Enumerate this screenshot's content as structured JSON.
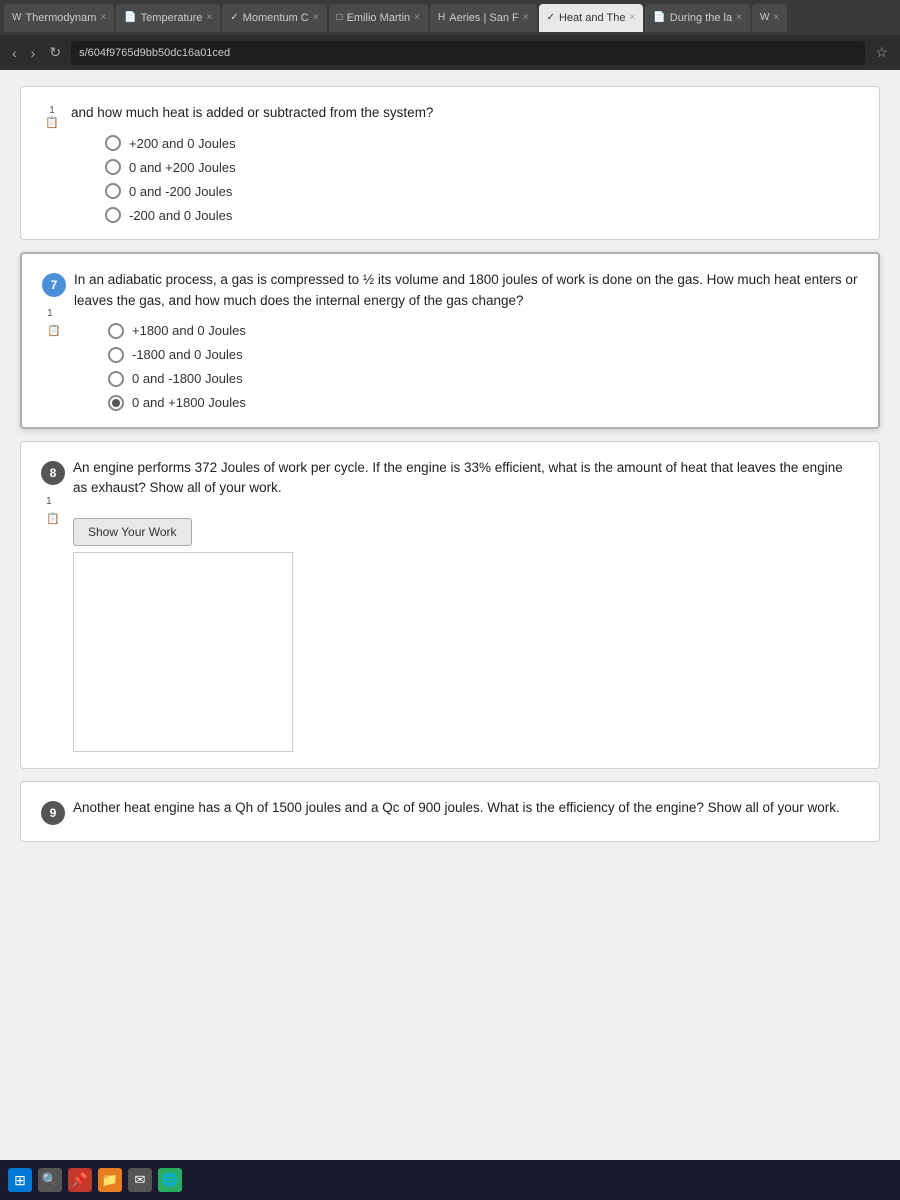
{
  "browser": {
    "tabs": [
      {
        "id": "tab1",
        "label": "Thermodynam",
        "icon": "W",
        "active": false
      },
      {
        "id": "tab2",
        "label": "Temperature",
        "icon": "📄",
        "active": false
      },
      {
        "id": "tab3",
        "label": "Momentum C",
        "icon": "✓",
        "active": false
      },
      {
        "id": "tab4",
        "label": "Emilio Martin",
        "icon": "□",
        "active": false
      },
      {
        "id": "tab5",
        "label": "Aeries | San F",
        "icon": "H",
        "active": false
      },
      {
        "id": "tab6",
        "label": "Heat and The",
        "icon": "✓",
        "active": true
      },
      {
        "id": "tab7",
        "label": "During the la",
        "icon": "📄",
        "active": false
      },
      {
        "id": "tab8",
        "label": "W",
        "icon": "W",
        "active": false
      }
    ],
    "address": "s/604f9765d9bb50dc16a01ced"
  },
  "questions": {
    "q6_partial": {
      "question_text": "and how much heat is added or subtracted from the system?",
      "options": [
        {
          "id": "opt1",
          "text": "+200 and 0 Joules",
          "selected": false
        },
        {
          "id": "opt2",
          "text": "0 and +200 Joules",
          "selected": false
        },
        {
          "id": "opt3",
          "text": "0 and -200 Joules",
          "selected": false
        },
        {
          "id": "opt4",
          "text": "-200 and 0 Joules",
          "selected": false
        }
      ]
    },
    "q7": {
      "number": "7",
      "question_text": "In an adiabatic process, a gas is compressed to ½ its volume and 1800 joules of work is done on the gas.  How much heat enters or leaves the gas, and how much does the internal energy of the gas change?",
      "options": [
        {
          "id": "opt1",
          "text": "+1800 and 0 Joules",
          "selected": false
        },
        {
          "id": "opt2",
          "text": "-1800 and 0 Joules",
          "selected": false
        },
        {
          "id": "opt3",
          "text": "0 and -1800 Joules",
          "selected": false
        },
        {
          "id": "opt4",
          "text": "0 and +1800 Joules",
          "selected": true
        }
      ]
    },
    "q8": {
      "number": "8",
      "question_text": "An engine performs 372 Joules of work per cycle.  If the engine is 33% efficient, what is the amount of heat that leaves the engine as exhaust? Show all of your work.",
      "show_work_label": "Show Your Work"
    },
    "q9": {
      "number": "9",
      "question_text": "Another heat engine has a Qh of 1500 joules and a Qc of 900 joules.  What is the efficiency of the engine?  Show all of your work."
    }
  },
  "taskbar": {
    "items": [
      {
        "id": "windows",
        "icon": "⊞",
        "type": "windows"
      },
      {
        "id": "search",
        "icon": "🔍",
        "type": "search"
      },
      {
        "id": "pin1",
        "icon": "📌",
        "type": "pin"
      },
      {
        "id": "folder",
        "icon": "📁",
        "type": "folder"
      },
      {
        "id": "mail",
        "icon": "✉",
        "type": "mail"
      },
      {
        "id": "browser",
        "icon": "🌐",
        "type": "browser"
      }
    ]
  }
}
